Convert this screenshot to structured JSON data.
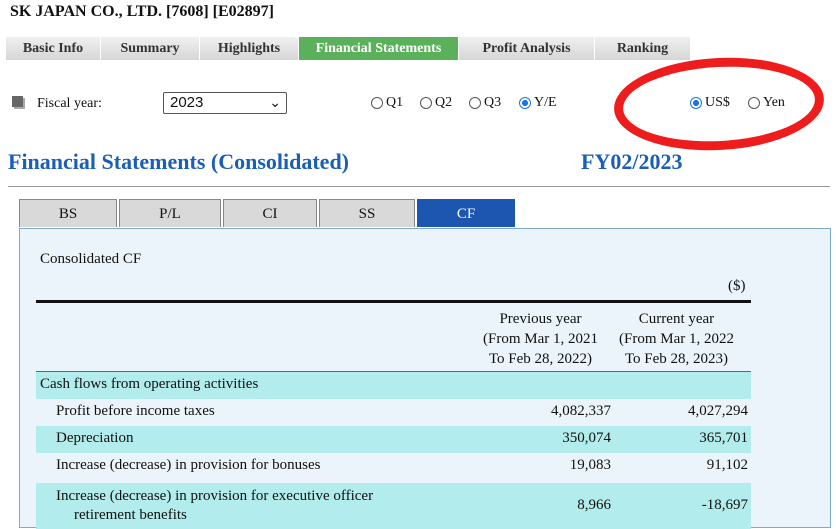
{
  "company": "SK JAPAN CO., LTD. [7608] [E02897]",
  "main_tabs": [
    "Basic Info",
    "Summary",
    "Highlights",
    "Financial Statements",
    "Profit Analysis",
    "Ranking"
  ],
  "fiscal": {
    "label": "Fiscal year:",
    "year": "2023",
    "periods": [
      "Q1",
      "Q2",
      "Q3",
      "Y/E"
    ],
    "selected_period": "Y/E",
    "currencies": [
      "US$",
      "Yen"
    ],
    "selected_currency": "US$"
  },
  "section": {
    "title": "Financial Statements (Consolidated)",
    "period": "FY02/2023"
  },
  "sub_tabs": [
    "BS",
    "P/L",
    "CI",
    "SS",
    "CF"
  ],
  "active_sub_tab": "CF",
  "table": {
    "caption": "Consolidated CF",
    "currency_note": "($)",
    "columns": [
      "Previous year\n(From Mar 1, 2021\nTo Feb 28, 2022)",
      "Current year\n(From Mar 1, 2022\nTo Feb 28, 2023)"
    ],
    "rows": [
      {
        "label": "Cash flows from operating activities",
        "prev": "",
        "curr": ""
      },
      {
        "label": "Profit before income taxes",
        "prev": "4,082,337",
        "curr": "4,027,294"
      },
      {
        "label": "Depreciation",
        "prev": "350,074",
        "curr": "365,701"
      },
      {
        "label": "Increase (decrease) in provision for bonuses",
        "prev": "19,083",
        "curr": "91,102"
      },
      {
        "label": "Increase (decrease) in provision for executive officer",
        "label2": "retirement benefits",
        "prev": "8,966",
        "curr": "-18,697"
      }
    ]
  }
}
